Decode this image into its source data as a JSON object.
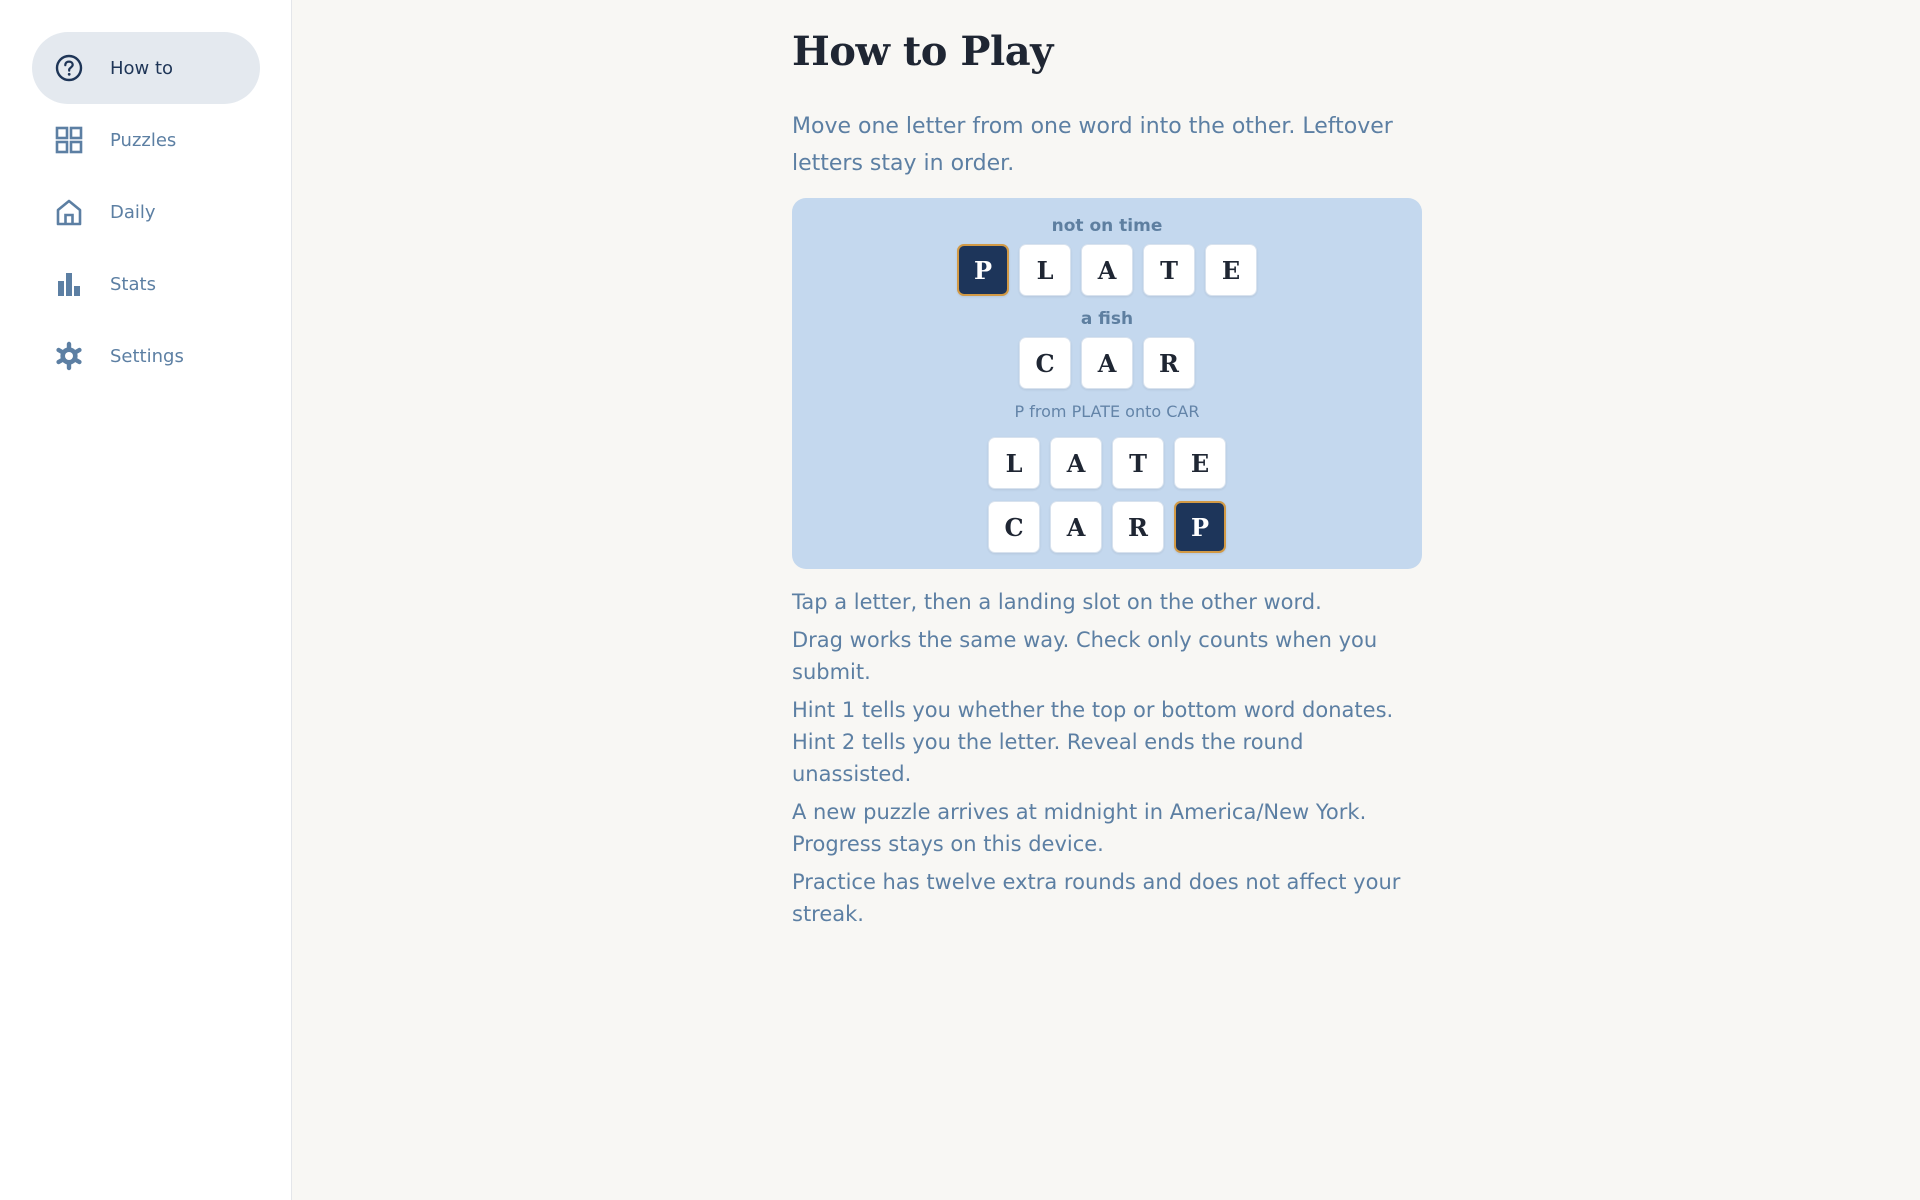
{
  "sidebar": {
    "items": [
      {
        "label": "How to",
        "icon": "help-circle-icon",
        "active": true
      },
      {
        "label": "Puzzles",
        "icon": "grid-icon",
        "active": false
      },
      {
        "label": "Daily",
        "icon": "home-icon",
        "active": false
      },
      {
        "label": "Stats",
        "icon": "bar-chart-icon",
        "active": false
      },
      {
        "label": "Settings",
        "icon": "gear-icon",
        "active": false
      }
    ]
  },
  "main": {
    "title": "How to Play",
    "intro": "Move one letter from one word into the other. Leftover letters stay in order.",
    "example": {
      "clue_top": "not on time",
      "word_top": [
        "P",
        "L",
        "A",
        "T",
        "E"
      ],
      "clue_bottom": "a fish",
      "word_bottom": [
        "C",
        "A",
        "R"
      ],
      "caption": "P from PLATE onto CAR",
      "result_top": [
        "L",
        "A",
        "T",
        "E"
      ],
      "result_bottom": [
        "C",
        "A",
        "R",
        "P"
      ]
    },
    "rules": [
      "Tap a letter, then a landing slot on the other word.",
      "Drag works the same way. Check only counts when you submit.",
      "Hint 1 tells you whether the top or bottom word donates. Hint 2 tells you the letter. Reveal ends the round unassisted.",
      "A new puzzle arrives at midnight in America/New York. Progress stays on this device.",
      "Practice has twelve extra rounds and does not affect your streak."
    ]
  },
  "colors": {
    "accent": "#1d355a",
    "tile_highlight_border": "#d29a46",
    "example_bg": "#c4d8ee",
    "text_muted": "#5c7fa3"
  }
}
